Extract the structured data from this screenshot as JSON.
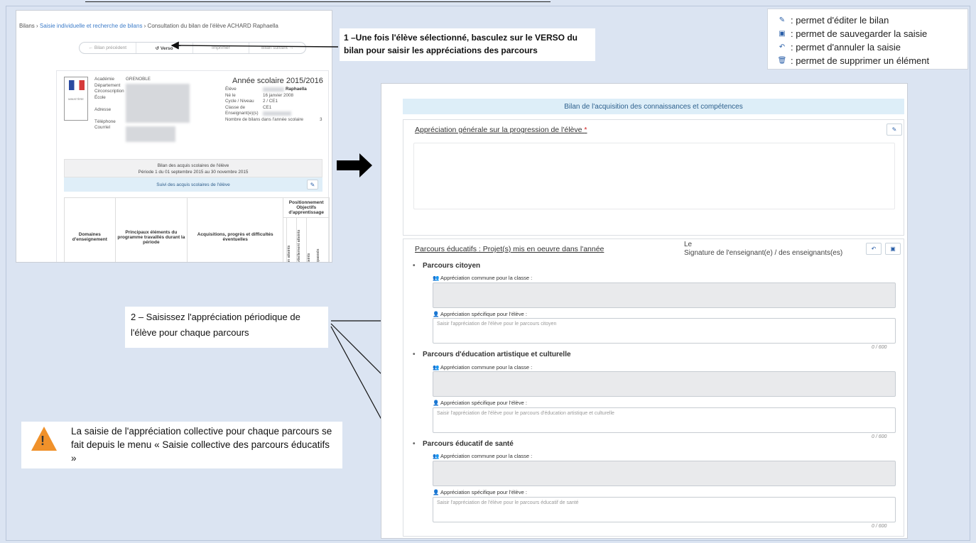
{
  "legend": [
    {
      "icon": "pencil-icon",
      "glyph": "✎",
      "text": ": permet d'éditer le bilan"
    },
    {
      "icon": "save-icon",
      "glyph": "▣",
      "text": ": permet de sauvegarder la saisie"
    },
    {
      "icon": "undo-icon",
      "glyph": "↶",
      "text": ": permet d'annuler la saisie"
    },
    {
      "icon": "trash-icon",
      "glyph": "🗑",
      "text": ": permet de supprimer un élément"
    }
  ],
  "shot1": {
    "breadcrumb": {
      "root": "Bilans",
      "link": "Saisie individuelle et recherche de bilans",
      "current": "Consultation du bilan de l'élève ACHARD Raphaella"
    },
    "nav": {
      "prev": "← Bilan précédent",
      "verso": "↺ Verso",
      "print": "Imprimer",
      "next": "Bilan suivant →"
    },
    "academie_labels": "Académie\nDépartement\nCirconscription\nÉcole\n\nAdresse\n\nTéléphone\nCourriel",
    "academie_value": "GRENOBLE",
    "annee": "Année scolaire 2015/2016",
    "eleve_labels": "Élève\nNé le\nCycle / Niveau\nClasse de\nEnseignant(e)(s)\nNombre de bilans dans l'année scolaire",
    "eleve_name": "Raphaella",
    "eleve_values": "16 janvier 2008\n2 / CE1\nCE1",
    "nb_bilans": "3",
    "summary_line1": "Bilan des acquis scolaires de l'élève",
    "summary_line2": "Période 1 du 01 septembre 2015 au 30 novembre 2015",
    "suivi": "Suivi des acquis scolaires de l'élève",
    "table": {
      "col1": "Domaines d'enseignement",
      "col2": "Principaux éléments du programme travaillés durant la période",
      "col3": "Acquisitions, progrès et difficultés éventuelles",
      "col4": "Positionnement Objectifs d'apprentissage",
      "levels": [
        "Non atteints",
        "Partiellement atteints",
        "Atteints",
        "Dépassés"
      ]
    }
  },
  "callouts": {
    "c1": "1 –Une fois l'élève sélectionné, basculez sur le VERSO du bilan pour saisir les appréciations des parcours",
    "c2": "2 – Saisissez l'appréciation périodique de l'élève pour chaque parcours",
    "c3": "La saisie de l'appréciation collective pour chaque parcours se fait depuis le menu « Saisie collective des parcours éducatifs »"
  },
  "shot2": {
    "header": "Bilan de l'acquisition des connaissances et compétences",
    "appreciation_title": "Appréciation générale sur la progression de l'élève",
    "required_mark": "*",
    "sign_le": "Le",
    "sign_text": "Signature de l'enseignant(e) / des enseignants(es)",
    "parcours_title": "Parcours éducatifs : Projet(s) mis en oeuvre dans l'année",
    "common_label": "Appréciation commune pour la classe :",
    "specific_label": "Appréciation spécifique pour l'élève :",
    "counter": "0 / 600",
    "parcours": [
      {
        "title": "Parcours citoyen",
        "placeholder": "Saisir l'appréciation de l'élève pour le parcours citoyen"
      },
      {
        "title": "Parcours d'éducation artistique et culturelle",
        "placeholder": "Saisir l'appréciation de l'élève pour le parcours d'éducation artistique et culturelle"
      },
      {
        "title": "Parcours éducatif de santé",
        "placeholder": "Saisir l'appréciation de l'élève pour le parcours éducatif de santé"
      }
    ]
  }
}
